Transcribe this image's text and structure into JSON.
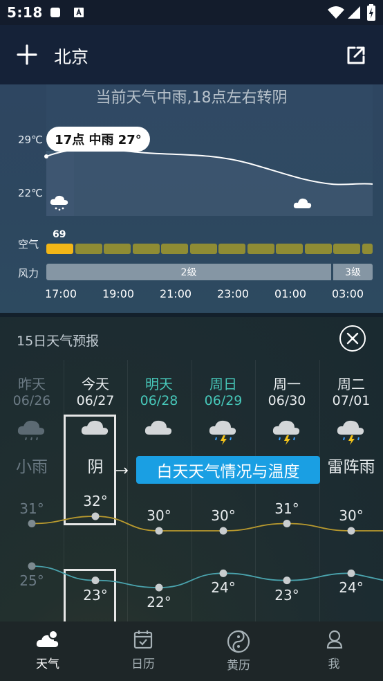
{
  "status": {
    "time": "5:18"
  },
  "header": {
    "city": "北京"
  },
  "nowcast": {
    "headline": "当前天气中雨,18点左右转阴",
    "y_high": "29℃",
    "y_low": "22℃",
    "tooltip": "17点 中雨 27°",
    "air_label": "空气",
    "aqi_value": "69",
    "wind_label": "风力",
    "wind_levels": [
      "2级",
      "3级"
    ],
    "hours": [
      "17:00",
      "19:00",
      "21:00",
      "23:00",
      "01:00",
      "03:00"
    ],
    "colors": {
      "aqi_now": "#f2b617",
      "aqi_later": "#8f8c34"
    }
  },
  "forecast": {
    "title": "15日天气预报",
    "callout": "白天天气情况与温度",
    "days": [
      {
        "name": "昨天",
        "date": "06/26",
        "cond": "小雨",
        "icon": "rain-cloud-icon",
        "hi": "31°",
        "lo": "25°"
      },
      {
        "name": "今天",
        "date": "06/27",
        "cond": "阴",
        "icon": "overcast-cloud-icon",
        "hi": "32°",
        "lo": "23°"
      },
      {
        "name": "明天",
        "date": "06/28",
        "cond": "",
        "icon": "overcast-cloud-icon",
        "hi": "30°",
        "lo": "22°"
      },
      {
        "name": "周日",
        "date": "06/29",
        "cond": "",
        "icon": "thunder-rain-icon",
        "hi": "30°",
        "lo": "24°"
      },
      {
        "name": "周一",
        "date": "06/30",
        "cond": "",
        "icon": "thunder-rain-icon",
        "hi": "31°",
        "lo": "23°"
      },
      {
        "name": "周二",
        "date": "07/01",
        "cond": "雷阵雨",
        "icon": "thunder-rain-icon",
        "hi": "30°",
        "lo": "24°"
      }
    ],
    "colors": {
      "past": "#6b7a84",
      "today": "#e8ecee",
      "highlight": "#47c7b9",
      "high_line": "#b99a2e",
      "low_line": "#4aa3ad"
    }
  },
  "nav": {
    "items": [
      {
        "label": "天气",
        "icon": "weather-icon",
        "active": "true"
      },
      {
        "label": "日历",
        "icon": "calendar-icon",
        "active": "false"
      },
      {
        "label": "黄历",
        "icon": "yin-yang-icon",
        "active": "false"
      },
      {
        "label": "我",
        "icon": "profile-icon",
        "active": "false"
      }
    ]
  }
}
